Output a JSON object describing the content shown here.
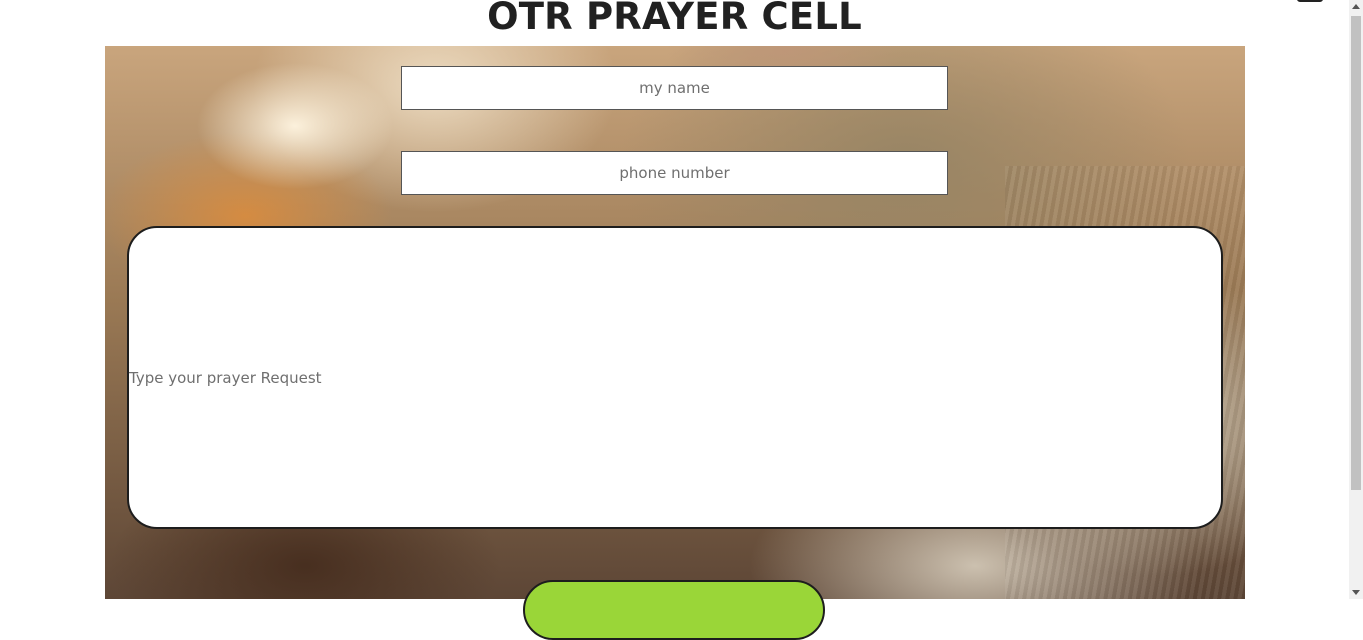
{
  "header": {
    "title": "OTR PRAYER CELL"
  },
  "form": {
    "name_placeholder": "my name",
    "phone_placeholder": "phone number",
    "request_placeholder": "Type your prayer Request",
    "submit_label": ""
  },
  "colors": {
    "submit_green": "#9ad638",
    "title_text": "#212121"
  }
}
